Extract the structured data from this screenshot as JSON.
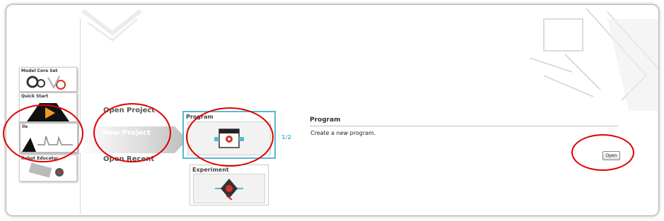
{
  "sidebar": {
    "tiles": [
      {
        "label": "Model Core Set"
      },
      {
        "label": "Quick Start"
      },
      {
        "label": "ile"
      },
      {
        "label": "Robot Educator"
      }
    ]
  },
  "menu": {
    "open_project": "Open Project",
    "new_project": "New Project",
    "open_recent": "Open Recent"
  },
  "cards": {
    "program_label": "Program",
    "experiment_label": "Experiment",
    "pager": "1/2"
  },
  "description": {
    "title": "Program",
    "text": "Create a new program.",
    "open_button": "Open"
  },
  "colors": {
    "accent": "#5ab7cf",
    "highlight_circle": "#e00000",
    "logo_red": "#d93025"
  }
}
